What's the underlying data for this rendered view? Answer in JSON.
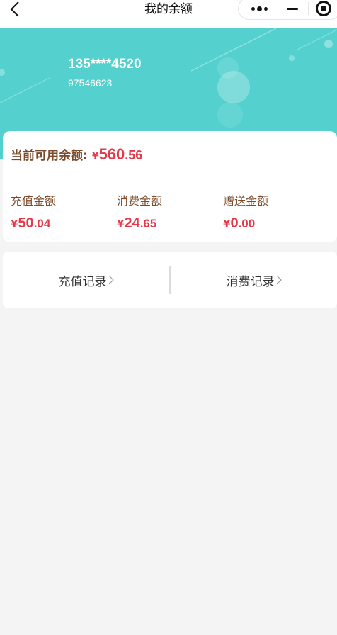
{
  "navbar": {
    "title": "我的余额",
    "back_icon": "chevron-left-icon",
    "more_icon": "more-dots-icon",
    "minimize_icon": "minimize-icon",
    "close_icon": "target-close-icon"
  },
  "user": {
    "phone": "135****4520",
    "id": "97546623"
  },
  "balance": {
    "available_label": "当前可用余额:",
    "currency": "¥",
    "available_int": "560",
    "available_dec": ".56",
    "items": [
      {
        "label": "充值金额",
        "currency": "¥",
        "int": "50",
        "dec": ".04"
      },
      {
        "label": "消费金额",
        "currency": "¥",
        "int": "24",
        "dec": ".65"
      },
      {
        "label": "赠送金额",
        "currency": "¥",
        "int": "0",
        "dec": ".00"
      }
    ]
  },
  "records": {
    "recharge_label": "充值记录",
    "consume_label": "消费记录",
    "chevron_icon": "chevron-right-icon"
  },
  "colors": {
    "header_bg": "#54d1ce",
    "amount_red": "#e23a4a",
    "label_brown": "#7a4a2a",
    "page_bg": "#f4f4f4"
  }
}
